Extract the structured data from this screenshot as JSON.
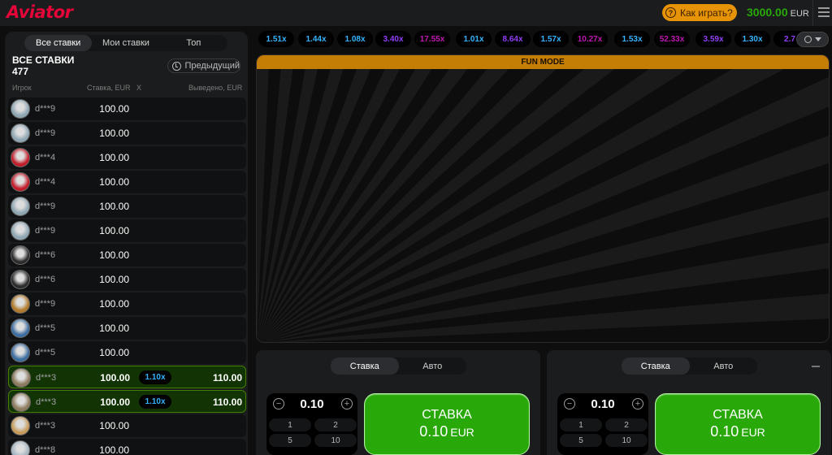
{
  "header": {
    "logo": "Aviator",
    "how_to_play": "Как играть?",
    "balance": "3000.00",
    "currency": "EUR"
  },
  "bets_panel": {
    "tabs": [
      {
        "label": "Все ставки",
        "active": true
      },
      {
        "label": "Мои ставки",
        "active": false
      },
      {
        "label": "Топ",
        "active": false
      }
    ],
    "title": "ВСЕ СТАВКИ",
    "count": "477",
    "previous_label": "Предыдущий",
    "columns": {
      "player": "Игрок",
      "bet": "Ставка, EUR",
      "mult": "X",
      "cashout": "Выведено, EUR"
    },
    "rows": [
      {
        "player": "d***9",
        "bet": "100.00",
        "mult": "",
        "cashout": "",
        "avatar": "#8fa6b3",
        "won": false
      },
      {
        "player": "d***9",
        "bet": "100.00",
        "mult": "",
        "cashout": "",
        "avatar": "#8fa6b3",
        "won": false
      },
      {
        "player": "d***4",
        "bet": "100.00",
        "mult": "",
        "cashout": "",
        "avatar": "#c21d2b",
        "won": false
      },
      {
        "player": "d***4",
        "bet": "100.00",
        "mult": "",
        "cashout": "",
        "avatar": "#c21d2b",
        "won": false
      },
      {
        "player": "d***9",
        "bet": "100.00",
        "mult": "",
        "cashout": "",
        "avatar": "#8fa6b3",
        "won": false
      },
      {
        "player": "d***9",
        "bet": "100.00",
        "mult": "",
        "cashout": "",
        "avatar": "#8fa6b3",
        "won": false
      },
      {
        "player": "d***6",
        "bet": "100.00",
        "mult": "",
        "cashout": "",
        "avatar": "#2c2c2c",
        "won": false
      },
      {
        "player": "d***6",
        "bet": "100.00",
        "mult": "",
        "cashout": "",
        "avatar": "#2c2c2c",
        "won": false
      },
      {
        "player": "d***9",
        "bet": "100.00",
        "mult": "",
        "cashout": "",
        "avatar": "#b07a2a",
        "won": false
      },
      {
        "player": "d***5",
        "bet": "100.00",
        "mult": "",
        "cashout": "",
        "avatar": "#3d6ea0",
        "won": false
      },
      {
        "player": "d***5",
        "bet": "100.00",
        "mult": "",
        "cashout": "",
        "avatar": "#3d6ea0",
        "won": false
      },
      {
        "player": "d***3",
        "bet": "100.00",
        "mult": "1.10x",
        "cashout": "110.00",
        "avatar": "#8d7b5e",
        "won": true
      },
      {
        "player": "d***3",
        "bet": "100.00",
        "mult": "1.10x",
        "cashout": "110.00",
        "avatar": "#8d7b5e",
        "won": true
      },
      {
        "player": "d***3",
        "bet": "100.00",
        "mult": "",
        "cashout": "",
        "avatar": "#c79b5a",
        "won": false
      },
      {
        "player": "d***8",
        "bet": "100.00",
        "mult": "",
        "cashout": "",
        "avatar": "#a4b4c0",
        "won": false
      }
    ]
  },
  "history": [
    {
      "v": "1.51x",
      "c": "#34b4ff"
    },
    {
      "v": "1.44x",
      "c": "#34b4ff"
    },
    {
      "v": "1.08x",
      "c": "#34b4ff"
    },
    {
      "v": "3.40x",
      "c": "#913ef8"
    },
    {
      "v": "17.55x",
      "c": "#c017b4"
    },
    {
      "v": "1.01x",
      "c": "#34b4ff"
    },
    {
      "v": "8.64x",
      "c": "#913ef8"
    },
    {
      "v": "1.57x",
      "c": "#34b4ff"
    },
    {
      "v": "10.27x",
      "c": "#c017b4"
    },
    {
      "v": "1.53x",
      "c": "#34b4ff"
    },
    {
      "v": "52.33x",
      "c": "#c017b4"
    },
    {
      "v": "3.59x",
      "c": "#913ef8"
    },
    {
      "v": "1.30x",
      "c": "#34b4ff"
    },
    {
      "v": "2.7",
      "c": "#913ef8"
    }
  ],
  "game": {
    "banner": "FUN MODE"
  },
  "bet_panels": [
    {
      "tab_bet": "Ставка",
      "tab_auto": "Авто",
      "amount": "0.10",
      "quick": [
        "1",
        "2",
        "5",
        "10"
      ],
      "button_label": "СТАВКА",
      "button_amount": "0.10",
      "button_currency": "EUR"
    },
    {
      "tab_bet": "Ставка",
      "tab_auto": "Авто",
      "amount": "0.10",
      "quick": [
        "1",
        "2",
        "5",
        "10"
      ],
      "button_label": "СТАВКА",
      "button_amount": "0.10",
      "button_currency": "EUR"
    }
  ],
  "colors": {
    "brand": "#e50539",
    "green": "#28a909",
    "amber": "#c47d05",
    "blue_mult": "#34b4ff"
  }
}
